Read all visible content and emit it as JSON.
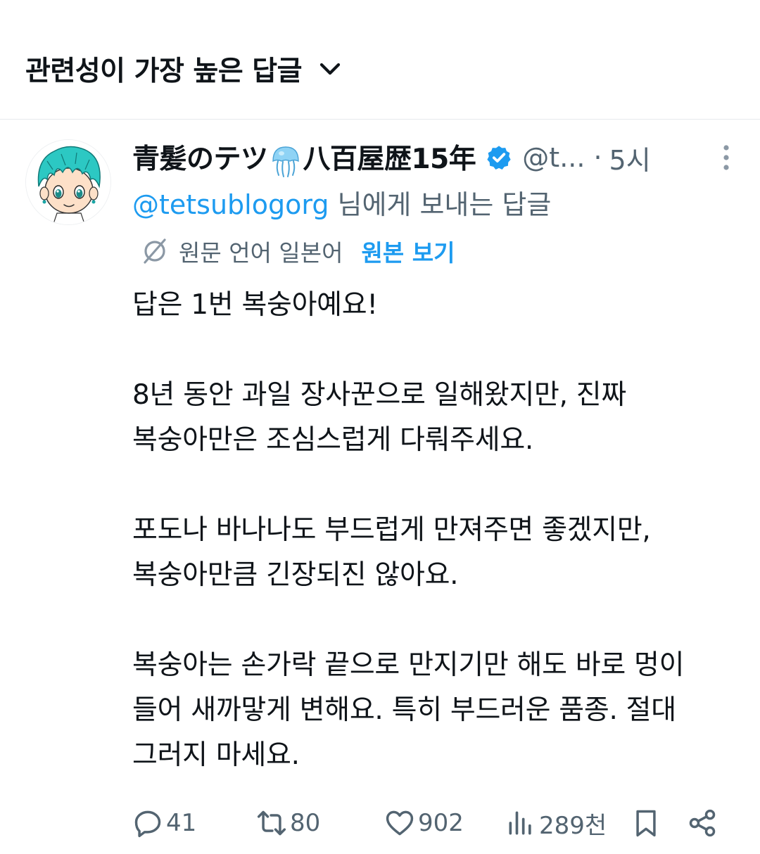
{
  "sort": {
    "label": "관련성이 가장 높은 답글",
    "icon": "chevron-down-icon"
  },
  "tweet": {
    "author": {
      "name_part1": "青髪のテツ",
      "name_emoji": "jellyfish",
      "name_part2": "八百屋歴15年",
      "verified": true,
      "handle": "@t...",
      "separator": "·",
      "time": "5시"
    },
    "reply_to": {
      "mention": "@tetsublogorg",
      "suffix": " 님에게 보내는 답글"
    },
    "translation": {
      "text": "원문 언어 일본어",
      "view_original": "원본 보기"
    },
    "body": {
      "p1": "답은 1번 복숭아예요!",
      "p2_l1": "8년 동안 과일 장사꾼으로 일해왔지만, 진짜",
      "p2_l2": "복숭아만은 조심스럽게 다뤄주세요.",
      "p3_l1": "포도나 바나나도 부드럽게 만져주면 좋겠지만,",
      "p3_l2": "복숭아만큼 긴장되진 않아요.",
      "p4_l1": "복숭아는 손가락 끝으로 만지기만 해도 바로 멍이",
      "p4_l2": "들어 새까맣게 변해요. 특히 부드러운 품종. 절대",
      "p4_l3": "그러지 마세요."
    },
    "actions": {
      "replies": "41",
      "reposts": "80",
      "likes": "902",
      "views": "289천"
    }
  },
  "colors": {
    "text": "#0f1419",
    "secondary": "#536471",
    "accent": "#1d9bf0",
    "divider": "#e6e9ec"
  }
}
